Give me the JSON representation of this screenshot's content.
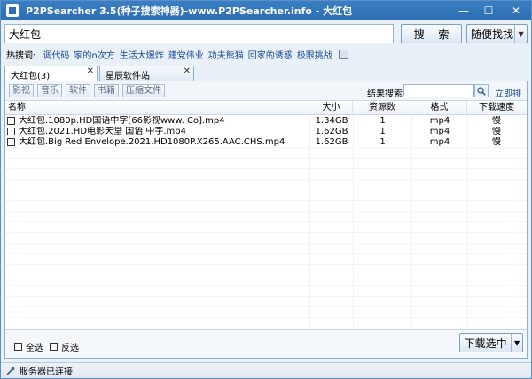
{
  "window": {
    "title": "P2PSearcher 3.5(种子搜索神器)-www.P2PSearcher.info - 大红包",
    "minimize": "—",
    "maximize": "☐",
    "close": "✕"
  },
  "search": {
    "value": "大红包",
    "button": "搜 索",
    "random_button": "随便找找"
  },
  "hot": {
    "label": "热搜词:",
    "items": [
      "调代码",
      "家的n次方",
      "生活大爆炸",
      "建党伟业",
      "功夫熊猫",
      "回家的诱惑",
      "极限挑战"
    ]
  },
  "tabs": [
    {
      "label": "大红包(3)",
      "active": true
    },
    {
      "label": "星辰软件站",
      "active": false
    }
  ],
  "filters": [
    "影视",
    "音乐",
    "软件",
    "书籍",
    "压缩文件"
  ],
  "result_search_label": "结果搜索:",
  "sort_link": "立即排序",
  "columns": {
    "name": "名称",
    "size": "大小",
    "sources": "资源数",
    "format": "格式",
    "speed": "下载速度"
  },
  "rows": [
    {
      "name": "大红包.1080p.HD国语中字[66影视www.      Co].mp4",
      "size": "1.34GB",
      "sources": "1",
      "format": "mp4",
      "speed": "慢"
    },
    {
      "name": "大红包.2021.HD电影天堂 国语 中字.mp4",
      "size": "1.62GB",
      "sources": "1",
      "format": "mp4",
      "speed": "慢"
    },
    {
      "name": "大红包.Big Red Envelope.2021.HD1080P.X265.AAC.CHS.mp4",
      "size": "1.62GB",
      "sources": "1",
      "format": "mp4",
      "speed": "慢"
    }
  ],
  "bottom": {
    "select_all": "全选",
    "invert": "反选",
    "download": "下载选中"
  },
  "status": {
    "text": "服务器已连接"
  },
  "colors": {
    "title_bar": "#2d6db3",
    "link": "#14479a"
  }
}
